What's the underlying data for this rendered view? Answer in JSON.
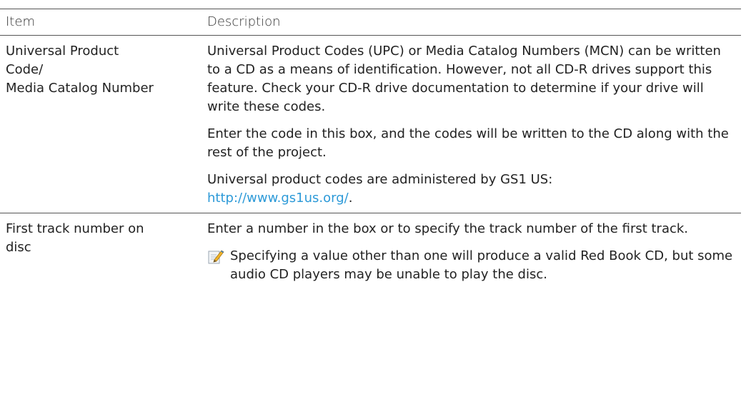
{
  "table": {
    "header": {
      "item": "Item",
      "description": "Description"
    },
    "rows": [
      {
        "item_lines": [
          "Universal Product",
          "Code/",
          "Media Catalog Number"
        ],
        "paragraphs": [
          "Universal Product Codes (UPC) or Media Catalog Numbers (MCN) can be written to a CD as a means of identification. However, not all CD-R drives support this feature. Check your CD-R drive documentation to determine if your drive will write these codes.",
          "Enter the code in this box, and the codes will be written to the CD along with the rest of the project."
        ],
        "link_paragraph": {
          "prefix": "Universal product codes are administered by GS1 US:",
          "link_text": "http://www.gs1us.org/",
          "suffix": "."
        }
      },
      {
        "item_lines": [
          "First track number on",
          "disc"
        ],
        "paragraphs": [
          "Enter a number in the box or to specify the track number of the first track."
        ],
        "note": {
          "icon": "note-pencil-icon",
          "text": "Specifying a value other than one will produce a valid Red Book CD, but some audio CD players may be unable to play the disc."
        }
      }
    ]
  },
  "colors": {
    "link": "#2d9ad8",
    "text": "#222222",
    "rule": "#555555"
  }
}
